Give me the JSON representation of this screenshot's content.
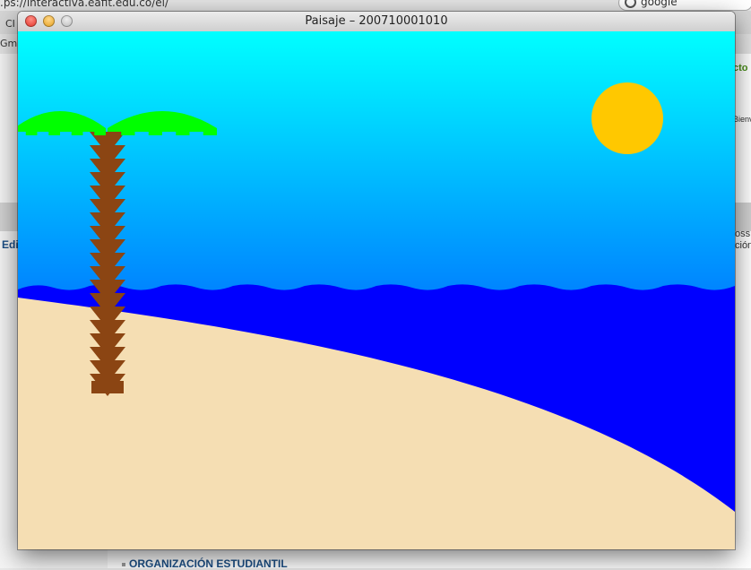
{
  "browser": {
    "url_fragment": ".ps://interactiva.eafit.edu.co/ei/",
    "search_value": "google",
    "tab_fragments": [
      "CI",
      "Gma"
    ],
    "right_fragments": [
      "cto",
      "Bienv",
      "oss",
      "ción"
    ],
    "left_fragment": "Edi",
    "bottom_link": "ORGANIZACIÓN ESTUDIANTIL"
  },
  "window": {
    "title": "Paisaje – 200710001010"
  },
  "scene": {
    "colors": {
      "sky_top": "#00ffff",
      "sky_bottom": "#0080ff",
      "sea": "#0000ff",
      "sand": "#f5deb3",
      "sun": "#ffc800",
      "trunk": "#8b4513",
      "leaves": "#00ff00"
    },
    "icons": [
      "sun",
      "palm-tree",
      "waves",
      "beach"
    ]
  }
}
